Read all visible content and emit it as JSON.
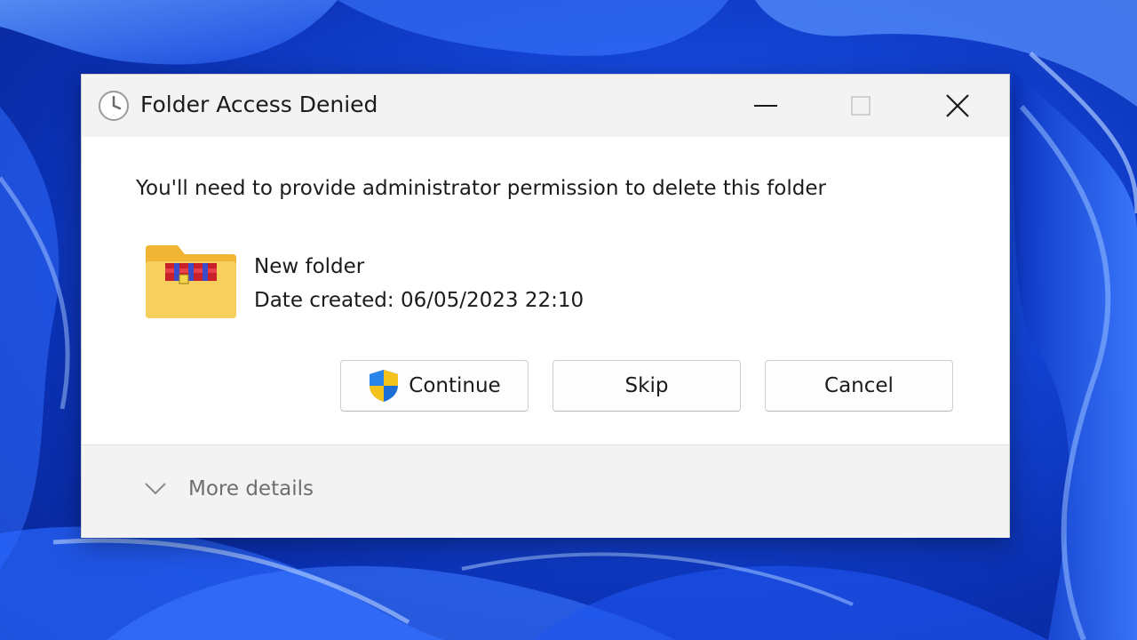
{
  "dialog": {
    "title": "Folder Access Denied",
    "message": "You'll need to provide administrator permission to delete this folder",
    "item": {
      "name": "New folder",
      "date_created": "Date created: 06/05/2023 22:10"
    },
    "buttons": {
      "continue_label": "Continue",
      "skip_label": "Skip",
      "cancel_label": "Cancel"
    },
    "more_details_label": "More details"
  },
  "icons": {
    "title": "clock-icon",
    "item": "compressed-folder-icon",
    "continue": "uac-shield-icon",
    "expander": "chevron-down-icon"
  },
  "colors": {
    "desktop_background": "#1446d8",
    "titlebar": "#f3f3f3",
    "dialog_body": "#ffffff",
    "footer": "#f3f3f3",
    "muted_text": "#6e6e6e"
  }
}
